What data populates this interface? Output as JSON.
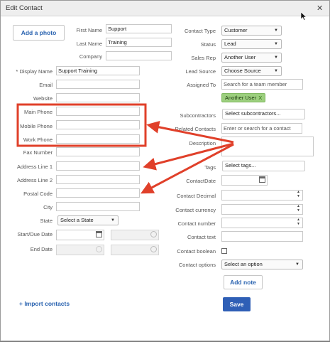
{
  "dialog": {
    "title": "Edit Contact",
    "add_photo": "Add a photo",
    "import_link": "+ Import contacts",
    "add_note": "Add note",
    "save": "Save"
  },
  "left_fields": {
    "first_name": {
      "label": "First Name",
      "value": "Support"
    },
    "last_name": {
      "label": "Last Name",
      "value": "Training"
    },
    "company": {
      "label": "Company",
      "value": ""
    },
    "display_name": {
      "label": "* Display Name",
      "value": "Support Training"
    },
    "email": {
      "label": "Email",
      "value": ""
    },
    "website": {
      "label": "Website",
      "value": ""
    },
    "main_phone": {
      "label": "Main Phone",
      "value": ""
    },
    "mobile_phone": {
      "label": "Mobile Phone",
      "value": ""
    },
    "work_phone": {
      "label": "Work Phone",
      "value": ""
    },
    "fax": {
      "label": "Fax Number",
      "value": ""
    },
    "address1": {
      "label": "Address Line 1",
      "value": ""
    },
    "address2": {
      "label": "Address Line 2",
      "value": ""
    },
    "postal": {
      "label": "Postal Code",
      "value": ""
    },
    "city": {
      "label": "City",
      "value": ""
    },
    "state": {
      "label": "State",
      "value": "Select a State"
    },
    "start_due": {
      "label": "Start/Due Date"
    },
    "end_date": {
      "label": "End Date"
    }
  },
  "right_fields": {
    "contact_type": {
      "label": "Contact Type",
      "value": "Customer"
    },
    "status": {
      "label": "Status",
      "value": "Lead"
    },
    "sales_rep": {
      "label": "Sales Rep",
      "value": "Another User"
    },
    "lead_source": {
      "label": "Lead Source",
      "value": "Choose Source"
    },
    "assigned_to": {
      "label": "Assigned To",
      "placeholder": "Search for a team member",
      "tag": "Another User",
      "tag_remove": "X"
    },
    "subcontractors": {
      "label": "Subcontractors",
      "value": "Select subcontractors..."
    },
    "related_contacts": {
      "label": "Related Contacts",
      "placeholder": "Enter or search for a contact"
    },
    "description": {
      "label": "Description"
    },
    "tags": {
      "label": "Tags",
      "value": "Select tags..."
    },
    "contact_date": {
      "label": "ContactDate"
    },
    "contact_decimal": {
      "label": "Contact Decimal"
    },
    "contact_currency": {
      "label": "Contact currency"
    },
    "contact_number": {
      "label": "Contact number"
    },
    "contact_text": {
      "label": "Contact text"
    },
    "contact_boolean": {
      "label": "Contact boolean"
    },
    "contact_options": {
      "label": "Contact options",
      "value": "Select an option"
    }
  },
  "icons": {
    "close": "close-icon",
    "cursor": "mouse-cursor-icon",
    "calendar": "calendar-icon",
    "clock": "clock-icon"
  },
  "colors": {
    "accent": "#2f5fb6",
    "link": "#2a63b0",
    "tag_bg": "#9ccf7e",
    "annotation": "#e0402a"
  }
}
